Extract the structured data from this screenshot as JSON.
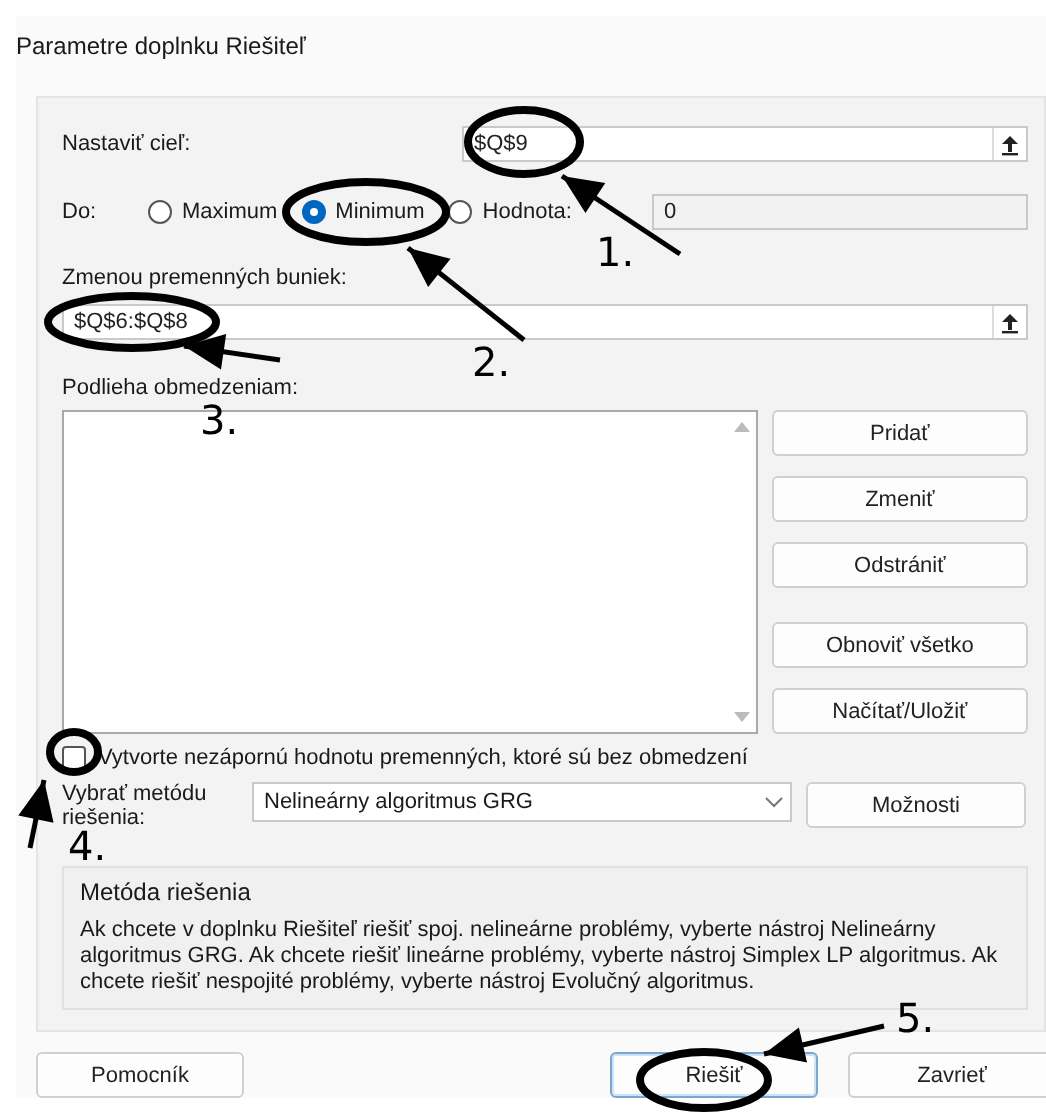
{
  "window": {
    "title": "Parametre doplnku Riešiteľ"
  },
  "objective": {
    "label": "Nastaviť cieľ:",
    "value": "$Q$9"
  },
  "to": {
    "label": "Do:",
    "value": "0",
    "options": [
      {
        "label": "Maximum",
        "selected": false
      },
      {
        "label": "Minimum",
        "selected": true
      },
      {
        "label": "Hodnota:",
        "selected": false
      }
    ]
  },
  "variables": {
    "label": "Zmenou premenných buniek:",
    "value": "$Q$6:$Q$8"
  },
  "constraints": {
    "label": "Podlieha obmedzeniam:",
    "buttons": [
      "Pridať",
      "Zmeniť",
      "Odstrániť",
      "Obnoviť všetko",
      "Načítať/Uložiť"
    ]
  },
  "nonnegative": {
    "label": "Vytvorte nezápornú hodnotu premenných, ktoré sú bez obmedzení",
    "checked": false
  },
  "method": {
    "label": "Vybrať metódu riešenia:",
    "value": "Nelineárny algoritmus GRG",
    "options_button": "Možnosti"
  },
  "method_info": {
    "title": "Metóda riešenia",
    "text": "Ak chcete v doplnku Riešiteľ riešiť spoj. nelineárne problémy, vyberte nástroj Nelineárny algoritmus GRG. Ak chcete riešiť lineárne problémy, vyberte nástroj Simplex LP algoritmus. Ak chcete riešiť nespojité problémy, vyberte nástroj Evolučný algoritmus."
  },
  "buttons": [
    {
      "label": "Pomocník",
      "default": false
    },
    {
      "label": "Riešiť",
      "default": true
    },
    {
      "label": "Zavrieť",
      "default": false
    }
  ],
  "annotations": [
    {
      "label": "1."
    },
    {
      "label": "2."
    },
    {
      "label": "3."
    },
    {
      "label": "4."
    },
    {
      "label": "5."
    }
  ]
}
